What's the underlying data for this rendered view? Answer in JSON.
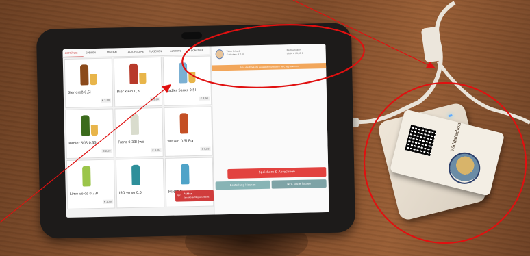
{
  "tablet": {
    "categories": [
      "GETRÄNKE",
      "SPEISEN",
      "MINERAL",
      "ALKOHOLFREI",
      "FLASCHEN",
      "ALKOHOL",
      "SONSTIGE"
    ],
    "products": [
      {
        "name": "Bier groß 0,5l",
        "price": "€ 3,90",
        "bottle": "#8b4a1b"
      },
      {
        "name": "Bier klein 0,3l",
        "price": "€ 2,60",
        "bottle": "#b83a2a"
      },
      {
        "name": "Radler Sauer 0,5l",
        "price": "€ 3,90",
        "bottle": "#7bb0d3"
      },
      {
        "name": "Radler SÜß 0,33l",
        "price": "€ 2,50",
        "bottle": "#3b6b1c"
      },
      {
        "name": "Franz 0,33l (we",
        "price": "€ 3,00",
        "bottle": "#d9dccd"
      },
      {
        "name": "Weizen 0,5l Fra",
        "price": "€ 3,80",
        "bottle": "#c44f24"
      },
      {
        "name": "Limo vo os 0,33l",
        "price": "€ 2,50",
        "bottle": "#9bc54a"
      },
      {
        "name": "ISO vo so 0,5l",
        "price": "",
        "bottle": "#2e8f9a"
      },
      {
        "name": "MINERAL vo st",
        "price": "",
        "bottle": "#4fa3c8"
      }
    ],
    "customer": {
      "left_lines": [
        "Victor Erhard",
        "Guthaben: € 0,00"
      ],
      "right_lines": [
        "Restguthaben",
        "00,00 € / 0,00 €"
      ],
      "notice": "Bitte die Produkte auswählen und dann NFC Tag scannen"
    },
    "buttons": {
      "save": "Speichern & Abrechnen",
      "back": "Bestellung löschen",
      "nfc": "NFC Tag erfassen"
    },
    "toast": {
      "title": "Fehler",
      "text": "Kein aktiver Mitglied erkannt"
    }
  },
  "card": {
    "text": "Waldstadioner SC Verein"
  },
  "colors": {
    "accent": "#e2423f",
    "annotation": "#e01010"
  }
}
